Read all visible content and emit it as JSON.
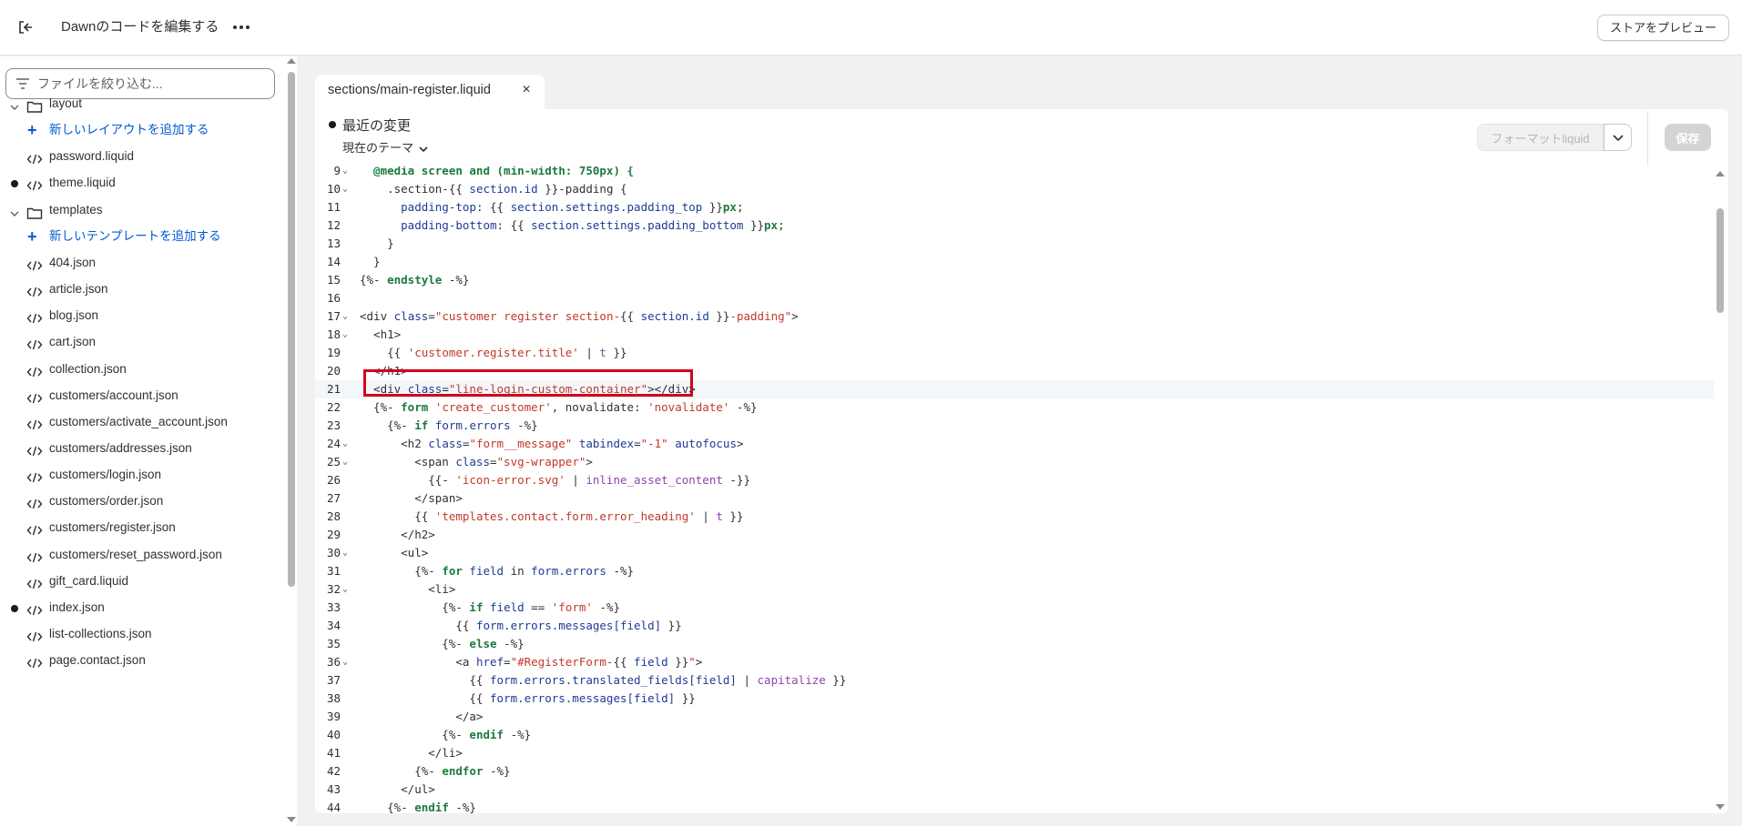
{
  "header": {
    "title": "Dawnのコードを編集する",
    "preview_label": "ストアをプレビュー"
  },
  "sidebar": {
    "filter_placeholder": "ファイルを絞り込む...",
    "items": [
      {
        "type": "folder",
        "label": "layout"
      },
      {
        "type": "add",
        "label": "新しいレイアウトを追加する"
      },
      {
        "type": "file",
        "label": "password.liquid",
        "modified": false
      },
      {
        "type": "file",
        "label": "theme.liquid",
        "modified": true
      },
      {
        "type": "folder",
        "label": "templates"
      },
      {
        "type": "add",
        "label": "新しいテンプレートを追加する"
      },
      {
        "type": "file",
        "label": "404.json",
        "modified": false
      },
      {
        "type": "file",
        "label": "article.json",
        "modified": false
      },
      {
        "type": "file",
        "label": "blog.json",
        "modified": false
      },
      {
        "type": "file",
        "label": "cart.json",
        "modified": false
      },
      {
        "type": "file",
        "label": "collection.json",
        "modified": false
      },
      {
        "type": "file",
        "label": "customers/account.json",
        "modified": false
      },
      {
        "type": "file",
        "label": "customers/activate_account.json",
        "modified": false
      },
      {
        "type": "file",
        "label": "customers/addresses.json",
        "modified": false
      },
      {
        "type": "file",
        "label": "customers/login.json",
        "modified": false
      },
      {
        "type": "file",
        "label": "customers/order.json",
        "modified": false
      },
      {
        "type": "file",
        "label": "customers/register.json",
        "modified": false
      },
      {
        "type": "file",
        "label": "customers/reset_password.json",
        "modified": false
      },
      {
        "type": "file",
        "label": "gift_card.liquid",
        "modified": false
      },
      {
        "type": "file",
        "label": "index.json",
        "modified": true
      },
      {
        "type": "file",
        "label": "list-collections.json",
        "modified": false
      },
      {
        "type": "file",
        "label": "page.contact.json",
        "modified": false
      }
    ]
  },
  "tab": {
    "prefix": "sections/",
    "file": "main-register.liquid",
    "close": "×"
  },
  "toolbar": {
    "changes_title": "最近の変更",
    "theme_select": "現在のテーマ",
    "format_label": "フォーマットliquid",
    "save_label": "保存"
  },
  "code": {
    "active_line": 21,
    "lines": [
      {
        "n": 9,
        "fold": true,
        "tokens": [
          [
            "kw",
            "  @media screen and (min-width: 750px) {"
          ]
        ]
      },
      {
        "n": 10,
        "fold": true,
        "tokens": [
          [
            "op",
            "    .section-"
          ],
          [
            "op",
            "{{ "
          ],
          [
            "var",
            "section.id"
          ],
          [
            "op",
            " }}"
          ],
          [
            "op",
            "-padding {"
          ]
        ]
      },
      {
        "n": 11,
        "fold": false,
        "tokens": [
          [
            "attr",
            "      padding-top"
          ],
          [
            "op",
            ": {{ "
          ],
          [
            "var",
            "section.settings.padding_top"
          ],
          [
            "op",
            " }}"
          ],
          [
            "kw",
            "px"
          ],
          [
            "op",
            ";"
          ]
        ]
      },
      {
        "n": 12,
        "fold": false,
        "tokens": [
          [
            "attr",
            "      padding-bottom"
          ],
          [
            "op",
            ": {{ "
          ],
          [
            "var",
            "section.settings.padding_bottom"
          ],
          [
            "op",
            " }}"
          ],
          [
            "kw",
            "px"
          ],
          [
            "op",
            ";"
          ]
        ]
      },
      {
        "n": 13,
        "fold": false,
        "tokens": [
          [
            "op",
            "    }"
          ]
        ]
      },
      {
        "n": 14,
        "fold": false,
        "tokens": [
          [
            "op",
            "  }"
          ]
        ]
      },
      {
        "n": 15,
        "fold": false,
        "tokens": [
          [
            "op",
            "{%- "
          ],
          [
            "kw",
            "endstyle"
          ],
          [
            "op",
            " -%}"
          ]
        ]
      },
      {
        "n": 16,
        "fold": false,
        "tokens": [
          [
            "op",
            ""
          ]
        ]
      },
      {
        "n": 17,
        "fold": true,
        "tokens": [
          [
            "tag",
            "<div "
          ],
          [
            "attr",
            "class"
          ],
          [
            "op",
            "="
          ],
          [
            "str",
            "\"customer register section-"
          ],
          [
            "op",
            "{{ "
          ],
          [
            "var",
            "section.id"
          ],
          [
            "op",
            " }}"
          ],
          [
            "str",
            "-padding\""
          ],
          [
            "tag",
            ">"
          ]
        ]
      },
      {
        "n": 18,
        "fold": true,
        "tokens": [
          [
            "tag",
            "  <h1>"
          ]
        ]
      },
      {
        "n": 19,
        "fold": false,
        "tokens": [
          [
            "op",
            "    {{ "
          ],
          [
            "str",
            "'customer.register.title'"
          ],
          [
            "op",
            " | "
          ],
          [
            "flt",
            "t"
          ],
          [
            "op",
            " }}"
          ]
        ]
      },
      {
        "n": 20,
        "fold": false,
        "tokens": [
          [
            "tag",
            "  </h1>"
          ]
        ]
      },
      {
        "n": 21,
        "fold": false,
        "tokens": [
          [
            "tag",
            "  <div "
          ],
          [
            "attr",
            "class"
          ],
          [
            "op",
            "="
          ],
          [
            "str",
            "\"line-login-custom-container\""
          ],
          [
            "tag",
            "></div>"
          ]
        ]
      },
      {
        "n": 22,
        "fold": false,
        "tokens": [
          [
            "op",
            "  {%- "
          ],
          [
            "kw",
            "form"
          ],
          [
            "op",
            " "
          ],
          [
            "str",
            "'create_customer'"
          ],
          [
            "op",
            ", novalidate: "
          ],
          [
            "str",
            "'novalidate'"
          ],
          [
            "op",
            " -%}"
          ]
        ]
      },
      {
        "n": 23,
        "fold": false,
        "tokens": [
          [
            "op",
            "    {%- "
          ],
          [
            "kw",
            "if"
          ],
          [
            "op",
            " "
          ],
          [
            "var",
            "form.errors"
          ],
          [
            "op",
            " -%}"
          ]
        ]
      },
      {
        "n": 24,
        "fold": true,
        "tokens": [
          [
            "tag",
            "      <h2 "
          ],
          [
            "attr",
            "class"
          ],
          [
            "op",
            "="
          ],
          [
            "str",
            "\"form__message\""
          ],
          [
            "op",
            " "
          ],
          [
            "attr",
            "tabindex"
          ],
          [
            "op",
            "="
          ],
          [
            "str",
            "\"-1\""
          ],
          [
            "op",
            " "
          ],
          [
            "attr",
            "autofocus"
          ],
          [
            "tag",
            ">"
          ]
        ]
      },
      {
        "n": 25,
        "fold": true,
        "tokens": [
          [
            "tag",
            "        <span "
          ],
          [
            "attr",
            "class"
          ],
          [
            "op",
            "="
          ],
          [
            "str",
            "\"svg-wrapper\""
          ],
          [
            "tag",
            ">"
          ]
        ]
      },
      {
        "n": 26,
        "fold": false,
        "tokens": [
          [
            "op",
            "          {{- "
          ],
          [
            "str",
            "'icon-error.svg'"
          ],
          [
            "op",
            " | "
          ],
          [
            "flt",
            "inline_asset_content"
          ],
          [
            "op",
            " -}}"
          ]
        ]
      },
      {
        "n": 27,
        "fold": false,
        "tokens": [
          [
            "tag",
            "        </span>"
          ]
        ]
      },
      {
        "n": 28,
        "fold": false,
        "tokens": [
          [
            "op",
            "        {{ "
          ],
          [
            "str",
            "'templates.contact.form.error_heading'"
          ],
          [
            "op",
            " | "
          ],
          [
            "flt",
            "t"
          ],
          [
            "op",
            " }}"
          ]
        ]
      },
      {
        "n": 29,
        "fold": false,
        "tokens": [
          [
            "tag",
            "      </h2>"
          ]
        ]
      },
      {
        "n": 30,
        "fold": true,
        "tokens": [
          [
            "tag",
            "      <ul>"
          ]
        ]
      },
      {
        "n": 31,
        "fold": false,
        "tokens": [
          [
            "op",
            "        {%- "
          ],
          [
            "kw",
            "for"
          ],
          [
            "op",
            " "
          ],
          [
            "var",
            "field"
          ],
          [
            "op",
            " in "
          ],
          [
            "var",
            "form.errors"
          ],
          [
            "op",
            " -%}"
          ]
        ]
      },
      {
        "n": 32,
        "fold": true,
        "tokens": [
          [
            "tag",
            "          <li>"
          ]
        ]
      },
      {
        "n": 33,
        "fold": false,
        "tokens": [
          [
            "op",
            "            {%- "
          ],
          [
            "kw",
            "if"
          ],
          [
            "op",
            " "
          ],
          [
            "var",
            "field"
          ],
          [
            "op",
            " == "
          ],
          [
            "str",
            "'form'"
          ],
          [
            "op",
            " -%}"
          ]
        ]
      },
      {
        "n": 34,
        "fold": false,
        "tokens": [
          [
            "op",
            "              {{ "
          ],
          [
            "var",
            "form.errors.messages[field]"
          ],
          [
            "op",
            " }}"
          ]
        ]
      },
      {
        "n": 35,
        "fold": false,
        "tokens": [
          [
            "op",
            "            {%- "
          ],
          [
            "kw",
            "else"
          ],
          [
            "op",
            " -%}"
          ]
        ]
      },
      {
        "n": 36,
        "fold": true,
        "tokens": [
          [
            "tag",
            "              <a "
          ],
          [
            "attr",
            "href"
          ],
          [
            "op",
            "="
          ],
          [
            "str",
            "\"#RegisterForm-"
          ],
          [
            "op",
            "{{ "
          ],
          [
            "var",
            "field"
          ],
          [
            "op",
            " }}"
          ],
          [
            "str",
            "\""
          ],
          [
            "tag",
            ">"
          ]
        ]
      },
      {
        "n": 37,
        "fold": false,
        "tokens": [
          [
            "op",
            "                {{ "
          ],
          [
            "var",
            "form.errors.translated_fields[field]"
          ],
          [
            "op",
            " | "
          ],
          [
            "flt",
            "capitalize"
          ],
          [
            "op",
            " }}"
          ]
        ]
      },
      {
        "n": 38,
        "fold": false,
        "tokens": [
          [
            "op",
            "                {{ "
          ],
          [
            "var",
            "form.errors.messages[field]"
          ],
          [
            "op",
            " }}"
          ]
        ]
      },
      {
        "n": 39,
        "fold": false,
        "tokens": [
          [
            "tag",
            "              </a>"
          ]
        ]
      },
      {
        "n": 40,
        "fold": false,
        "tokens": [
          [
            "op",
            "            {%- "
          ],
          [
            "kw",
            "endif"
          ],
          [
            "op",
            " -%}"
          ]
        ]
      },
      {
        "n": 41,
        "fold": false,
        "tokens": [
          [
            "tag",
            "          </li>"
          ]
        ]
      },
      {
        "n": 42,
        "fold": false,
        "tokens": [
          [
            "op",
            "        {%- "
          ],
          [
            "kw",
            "endfor"
          ],
          [
            "op",
            " -%}"
          ]
        ]
      },
      {
        "n": 43,
        "fold": false,
        "tokens": [
          [
            "tag",
            "      </ul>"
          ]
        ]
      },
      {
        "n": 44,
        "fold": false,
        "tokens": [
          [
            "op",
            "    {%- "
          ],
          [
            "kw",
            "endif"
          ],
          [
            "op",
            " -%}"
          ]
        ]
      }
    ]
  }
}
